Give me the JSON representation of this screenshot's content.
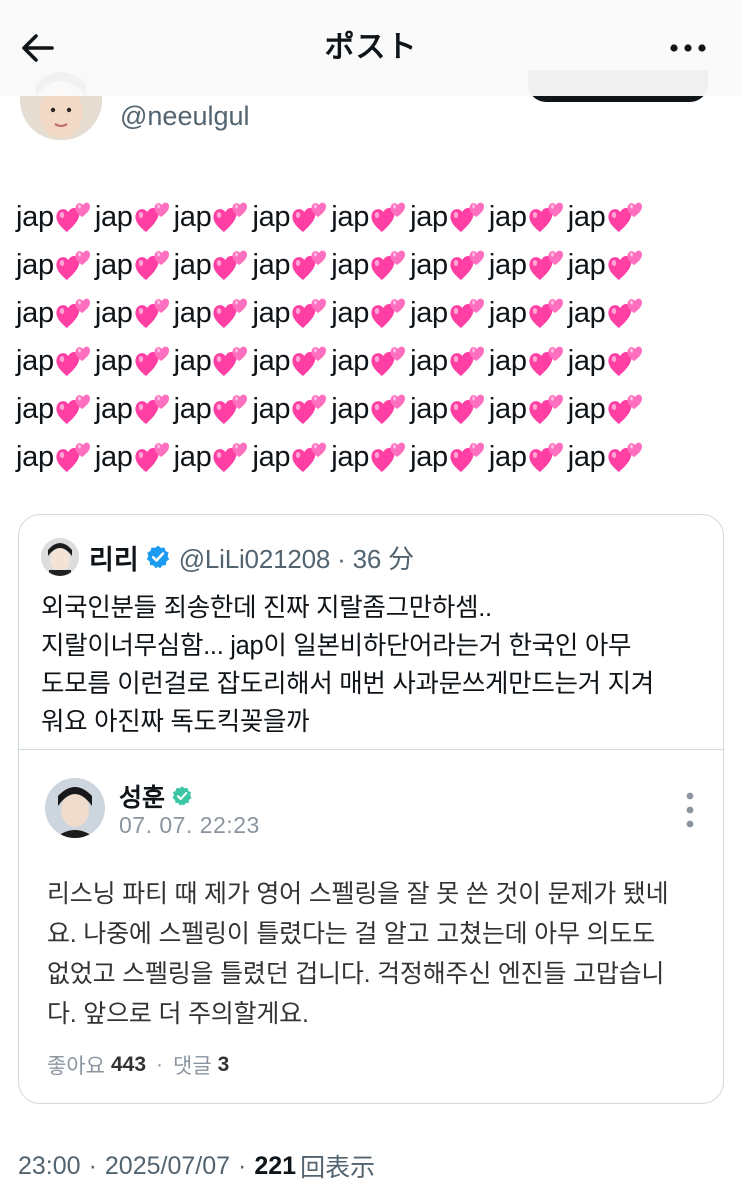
{
  "header": {
    "title": "ポスト",
    "back_icon": "arrow-left-icon",
    "more_icon": "more-horizontal-icon"
  },
  "author": {
    "handle": "@neeulgul"
  },
  "post": {
    "word": "jap",
    "emoji": "💕",
    "emoji_name": "two-hearts-icon",
    "lines": [
      [
        "jap",
        "jap",
        "jap",
        "jap",
        "jap",
        "jap",
        "jap",
        "jap"
      ],
      [
        "jap",
        "jap",
        "jap",
        "jap",
        "jap",
        "jap",
        "jap",
        "jap"
      ],
      [
        "jap",
        "jap",
        "jap",
        "jap",
        "jap",
        "jap",
        "jap",
        "jap"
      ],
      [
        "jap",
        "jap",
        "jap",
        "jap",
        "jap",
        "jap",
        "jap",
        "jap"
      ],
      [
        "jap",
        "jap",
        "jap",
        "jap",
        "jap",
        "jap",
        "jap",
        "jap"
      ],
      [
        "jap",
        "jap",
        "jap",
        "jap",
        "jap",
        "jap",
        "jap",
        "jap"
      ]
    ]
  },
  "quote": {
    "name": "리리",
    "handle_time": "@LiLi021208 · 36 分",
    "lines": [
      "외국인분들 죄송한데 진짜 지랄좀그만하셈..",
      "지랄이너무심함... jap이 일본비하단어라는거 한국인 아무",
      "도모름 이런걸로 잡도리해서 매번 사과문쓰게만드는거 지겨",
      "워요 아진짜 독도킥꽂을까"
    ],
    "embed": {
      "name": "성훈",
      "time": "07. 07. 22:23",
      "lines": [
        "리스닝 파티 때 제가 영어 스펠링을 잘 못 쓴 것이 문제가 됐네",
        "요. 나중에 스펠링이 틀렸다는 걸 알고 고쳤는데 아무 의도도",
        "없었고 스펠링을 틀렸던 겁니다. 걱정해주신 엔진들 고맙습니",
        "다. 앞으로 더 주의할게요."
      ],
      "likes_label": "좋아요",
      "likes_count": "443",
      "comments_label": "댓글",
      "comments_count": "3"
    }
  },
  "footer": {
    "time": "23:00",
    "date": "2025/07/07",
    "views_count": "221",
    "views_label": "回表示"
  },
  "colors": {
    "text": "#0f1419",
    "muted": "#536471",
    "border": "#cfd9de",
    "verified": "#1d9bf0",
    "heart": "#ff4fb0"
  }
}
